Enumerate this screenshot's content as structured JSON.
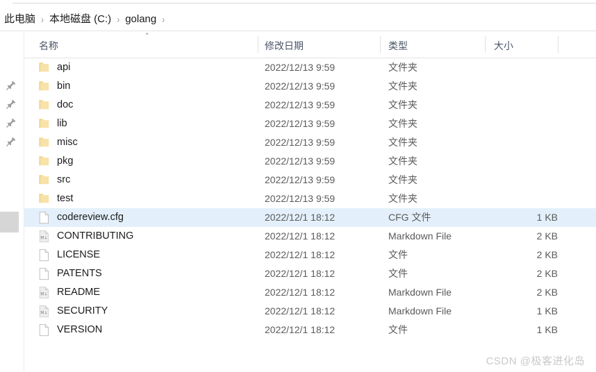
{
  "window": {
    "title": "golang"
  },
  "breadcrumb": {
    "separator": "›",
    "items": [
      {
        "label": "此电脑"
      },
      {
        "label": "本地磁盘 (C:)"
      },
      {
        "label": "golang"
      }
    ]
  },
  "sidebar": {
    "pins": [
      {
        "icon": "pin-icon",
        "label": ""
      },
      {
        "icon": "pin-icon",
        "label": ""
      },
      {
        "icon": "pin-icon",
        "label": ""
      },
      {
        "icon": "pin-icon",
        "label": ""
      }
    ],
    "scrollbar": {
      "icon": "scrollbar-thumb"
    }
  },
  "columns": {
    "name": "名称",
    "date_modified": "修改日期",
    "type": "类型",
    "size": "大小",
    "sort_indicator": "˄",
    "sorted_by": "name",
    "sort_direction": "ascending"
  },
  "colors": {
    "selection": "#e3f0fb",
    "folder_fill": "#f7e2a8",
    "folder_tab": "#f2d68a",
    "header_text": "#4a5568",
    "row_text": "#1b1b1b",
    "meta_text": "#5a5a5a",
    "watermark": "#c9c9c9"
  },
  "rows": [
    {
      "icon": "folder-icon",
      "name": "api",
      "date": "2022/12/13 9:59",
      "type": "文件夹",
      "size": "",
      "selected": false
    },
    {
      "icon": "folder-icon",
      "name": "bin",
      "date": "2022/12/13 9:59",
      "type": "文件夹",
      "size": "",
      "selected": false
    },
    {
      "icon": "folder-icon",
      "name": "doc",
      "date": "2022/12/13 9:59",
      "type": "文件夹",
      "size": "",
      "selected": false
    },
    {
      "icon": "folder-icon",
      "name": "lib",
      "date": "2022/12/13 9:59",
      "type": "文件夹",
      "size": "",
      "selected": false
    },
    {
      "icon": "folder-icon",
      "name": "misc",
      "date": "2022/12/13 9:59",
      "type": "文件夹",
      "size": "",
      "selected": false
    },
    {
      "icon": "folder-icon",
      "name": "pkg",
      "date": "2022/12/13 9:59",
      "type": "文件夹",
      "size": "",
      "selected": false
    },
    {
      "icon": "folder-icon",
      "name": "src",
      "date": "2022/12/13 9:59",
      "type": "文件夹",
      "size": "",
      "selected": false
    },
    {
      "icon": "folder-icon",
      "name": "test",
      "date": "2022/12/13 9:59",
      "type": "文件夹",
      "size": "",
      "selected": false
    },
    {
      "icon": "file-icon",
      "name": "codereview.cfg",
      "date": "2022/12/1 18:12",
      "type": "CFG 文件",
      "size": "1 KB",
      "selected": true
    },
    {
      "icon": "markdown-icon",
      "name": "CONTRIBUTING",
      "date": "2022/12/1 18:12",
      "type": "Markdown File",
      "size": "2 KB",
      "selected": false
    },
    {
      "icon": "file-icon",
      "name": "LICENSE",
      "date": "2022/12/1 18:12",
      "type": "文件",
      "size": "2 KB",
      "selected": false
    },
    {
      "icon": "file-icon",
      "name": "PATENTS",
      "date": "2022/12/1 18:12",
      "type": "文件",
      "size": "2 KB",
      "selected": false
    },
    {
      "icon": "markdown-icon",
      "name": "README",
      "date": "2022/12/1 18:12",
      "type": "Markdown File",
      "size": "2 KB",
      "selected": false
    },
    {
      "icon": "markdown-icon",
      "name": "SECURITY",
      "date": "2022/12/1 18:12",
      "type": "Markdown File",
      "size": "1 KB",
      "selected": false
    },
    {
      "icon": "file-icon",
      "name": "VERSION",
      "date": "2022/12/1 18:12",
      "type": "文件",
      "size": "1 KB",
      "selected": false
    }
  ],
  "watermark": {
    "text": "CSDN @极客进化岛"
  }
}
